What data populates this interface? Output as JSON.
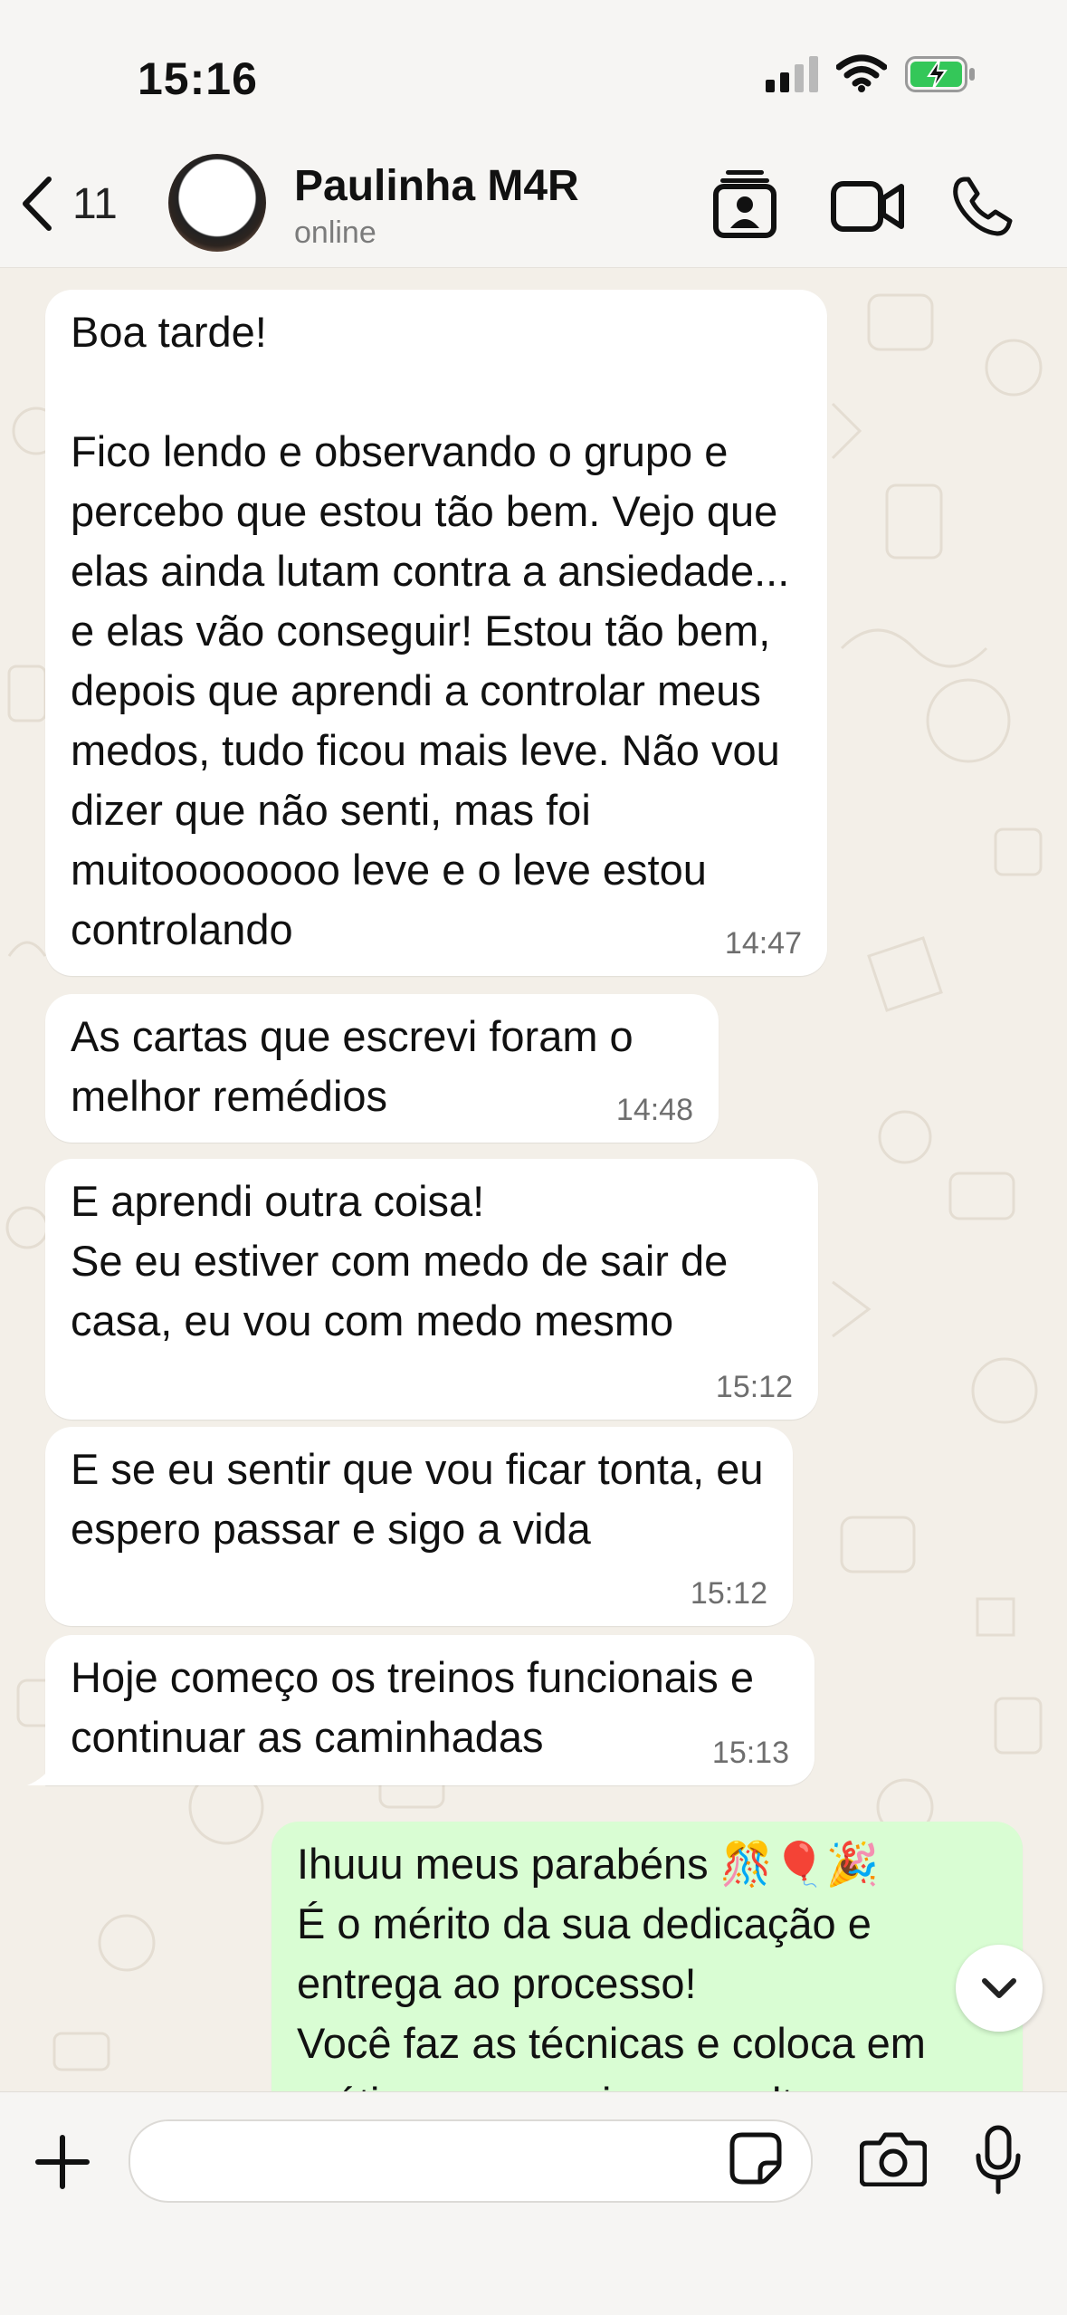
{
  "status_bar": {
    "time": "15:16"
  },
  "header": {
    "back_count": "11",
    "contact_name": "Paulinha M4R",
    "contact_status": "online"
  },
  "messages": [
    {
      "direction": "in",
      "text": "Boa tarde!\n\nFico lendo e observando o grupo e percebo que estou tão bem. Vejo que elas ainda lutam contra a ansiedade... e elas vão conseguir! Estou tão bem, depois que aprendi a controlar meus medos, tudo ficou mais leve. Não vou dizer que não senti, mas foi muitoooooooo leve e o leve estou controlando",
      "time": "14:47"
    },
    {
      "direction": "in",
      "text": "As cartas que escrevi foram o melhor remédios",
      "time": "14:48"
    },
    {
      "direction": "in",
      "text": "E aprendi outra coisa!\nSe eu estiver com medo de sair de casa, eu vou com medo mesmo",
      "time": "15:12"
    },
    {
      "direction": "in",
      "text": "E se eu sentir que vou ficar tonta, eu espero passar e sigo a vida",
      "time": "15:12"
    },
    {
      "direction": "in",
      "text": "Hoje começo os treinos funcionais e continuar as caminhadas",
      "time": "15:13"
    },
    {
      "direction": "out",
      "text": "Ihuuu meus parabéns 🎊🎈🎉\nÉ o mérito da sua dedicação e entrega ao processo!\nVocê faz as técnicas e coloca em prática sempre, isso resulta em",
      "time": ""
    }
  ],
  "composer": {
    "placeholder": ""
  },
  "icons": {
    "back": "chevron-left-icon",
    "contact_card": "contact-card-icon",
    "video": "video-camera-icon",
    "call": "phone-icon",
    "add": "plus-icon",
    "sticker": "sticker-icon",
    "camera": "camera-icon",
    "mic": "microphone-icon",
    "scroll_down": "chevron-down-icon"
  },
  "colors": {
    "incoming_bubble": "#ffffff",
    "outgoing_bubble": "#d9fdd3",
    "chat_background": "#f3efe8",
    "battery_green": "#34c759"
  }
}
